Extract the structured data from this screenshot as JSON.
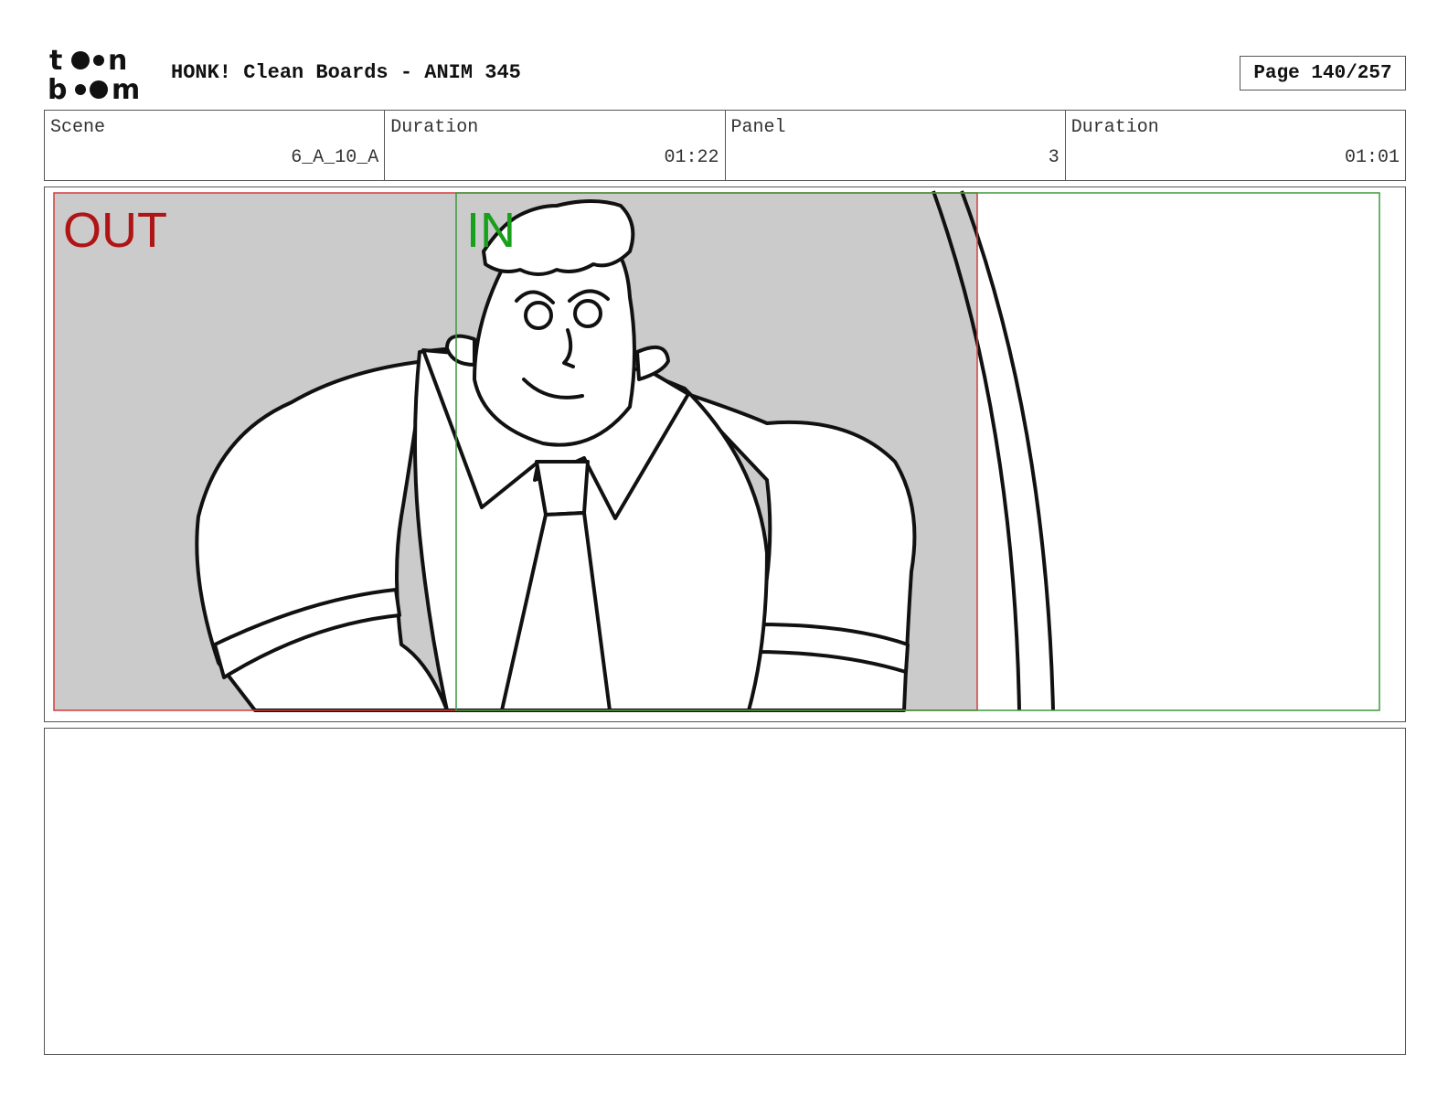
{
  "header": {
    "logo_top": "t●●n",
    "logo_bottom": "b●●m",
    "title": "HONK! Clean Boards - ANIM 345",
    "page": "Page 140/257"
  },
  "info": {
    "scene_label": "Scene",
    "scene_value": "6_A_10_A",
    "duration_label": "Duration",
    "duration_value": "01:22",
    "panel_label": "Panel",
    "panel_value": "3",
    "panel_duration_label": "Duration",
    "panel_duration_value": "01:01"
  },
  "frame": {
    "out_label": "OUT",
    "in_label": "IN",
    "out_color": "#b01515",
    "in_color": "#17a01a",
    "stage_gray": "#cbcbcb"
  },
  "notes": {
    "text": ""
  }
}
